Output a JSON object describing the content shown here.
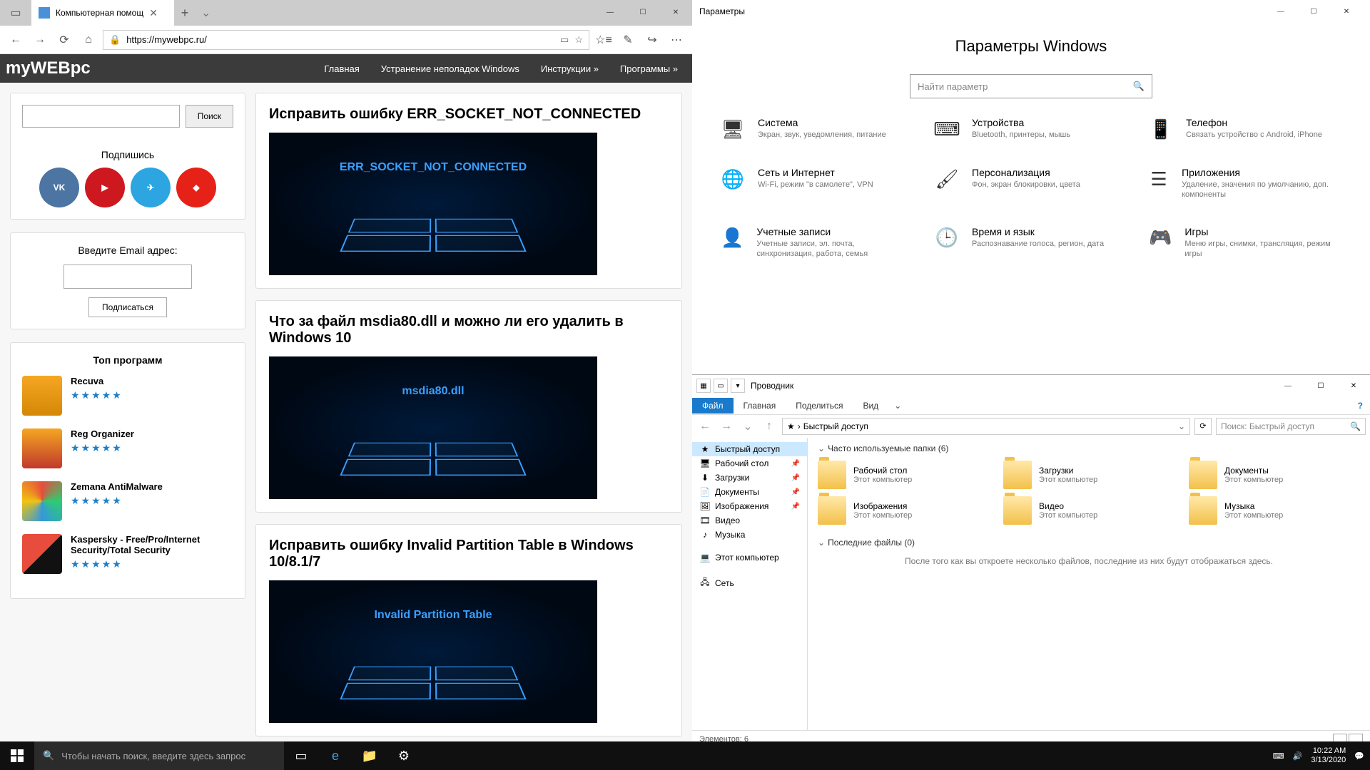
{
  "edge": {
    "tab_title": "Компьютерная помощ",
    "url": "https://mywebpc.ru/",
    "win": {
      "min": "—",
      "max": "☐",
      "close": "✕"
    }
  },
  "site": {
    "logo_a": "my",
    "logo_b": "WEB",
    "logo_c": "pc",
    "nav": [
      "Главная",
      "Устранение неполадок Windows",
      "Инструкции »",
      "Программы »"
    ],
    "search_btn": "Поиск",
    "subscribe_title": "Подпишись",
    "email_label": "Введите Email адрес:",
    "email_btn": "Подписаться",
    "top_title": "Топ программ",
    "programs": [
      {
        "name": "Recuva"
      },
      {
        "name": "Reg Organizer"
      },
      {
        "name": "Zemana AntiMalware"
      },
      {
        "name": "Kaspersky - Free/Pro/Internet Security/Total Security"
      }
    ],
    "posts": [
      {
        "title": "Исправить ошибку ERR_SOCKET_NOT_CONNECTED",
        "cap": "ERR_SOCKET_NOT_CONNECTED"
      },
      {
        "title": "Что за файл msdia80.dll и можно ли его удалить в Windows 10",
        "cap": "msdia80.dll"
      },
      {
        "title": "Исправить ошибку Invalid Partition Table в Windows 10/8.1/7",
        "cap": "Invalid Partition Table"
      }
    ]
  },
  "settings": {
    "window_title": "Параметры",
    "heading": "Параметры Windows",
    "search_placeholder": "Найти параметр",
    "items": [
      {
        "t": "Система",
        "d": "Экран, звук, уведомления, питание",
        "i": "🖥"
      },
      {
        "t": "Устройства",
        "d": "Bluetooth, принтеры, мышь",
        "i": "⌨"
      },
      {
        "t": "Телефон",
        "d": "Связать устройство с Android, iPhone",
        "i": "📱"
      },
      {
        "t": "Сеть и Интернет",
        "d": "Wi-Fi, режим \"в самолете\", VPN",
        "i": "🌐"
      },
      {
        "t": "Персонализация",
        "d": "Фон, экран блокировки, цвета",
        "i": "🖌"
      },
      {
        "t": "Приложения",
        "d": "Удаление, значения по умолчанию, доп. компоненты",
        "i": "☰"
      },
      {
        "t": "Учетные записи",
        "d": "Учетные записи, эл. почта, синхронизация, работа, семья",
        "i": "👤"
      },
      {
        "t": "Время и язык",
        "d": "Распознавание голоса, регион, дата",
        "i": "🕒"
      },
      {
        "t": "Игры",
        "d": "Меню игры, снимки, трансляция, режим игры",
        "i": "🎮"
      }
    ]
  },
  "explorer": {
    "title": "Проводник",
    "ribbon": {
      "file": "Файл",
      "home": "Главная",
      "share": "Поделиться",
      "view": "Вид"
    },
    "crumb": "Быстрый доступ",
    "search_placeholder": "Поиск: Быстрый доступ",
    "nav": [
      {
        "l": "Быстрый доступ",
        "i": "★",
        "sel": true
      },
      {
        "l": "Рабочий стол",
        "i": "🖥",
        "pin": true
      },
      {
        "l": "Загрузки",
        "i": "⬇",
        "pin": true
      },
      {
        "l": "Документы",
        "i": "📄",
        "pin": true
      },
      {
        "l": "Изображения",
        "i": "🖼",
        "pin": true
      },
      {
        "l": "Видео",
        "i": "🎞"
      },
      {
        "l": "Музыка",
        "i": "♪"
      }
    ],
    "nav2": [
      {
        "l": "Этот компьютер",
        "i": "💻"
      },
      {
        "l": "Сеть",
        "i": "🖧"
      }
    ],
    "section1": "Часто используемые папки (6)",
    "folders": [
      {
        "n": "Рабочий стол",
        "s": "Этот компьютер"
      },
      {
        "n": "Загрузки",
        "s": "Этот компьютер"
      },
      {
        "n": "Документы",
        "s": "Этот компьютер"
      },
      {
        "n": "Изображения",
        "s": "Этот компьютер"
      },
      {
        "n": "Видео",
        "s": "Этот компьютер"
      },
      {
        "n": "Музыка",
        "s": "Этот компьютер"
      }
    ],
    "section2": "Последние файлы (0)",
    "empty": "После того как вы откроете несколько файлов, последние из них будут отображаться здесь.",
    "status": "Элементов: 6"
  },
  "taskbar": {
    "search_placeholder": "Чтобы начать поиск, введите здесь запрос",
    "time": "10:22 AM",
    "date": "3/13/2020"
  }
}
